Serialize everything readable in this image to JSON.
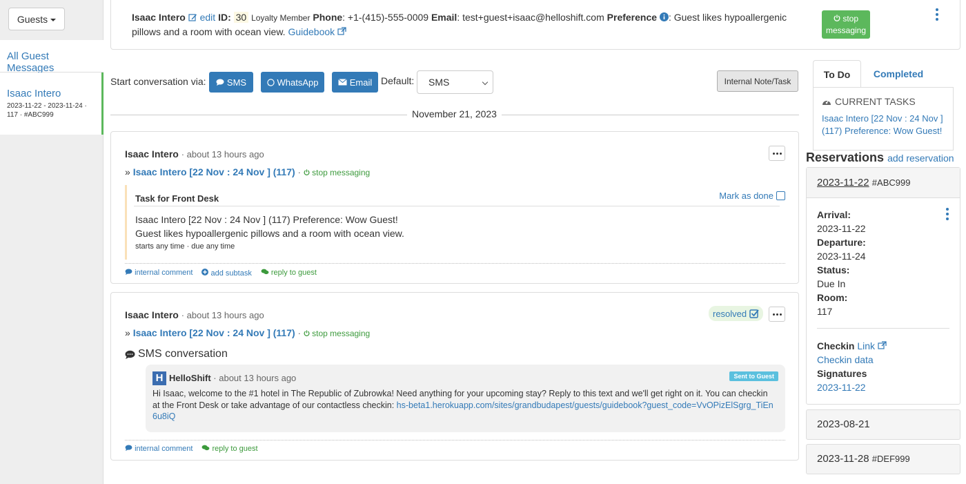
{
  "sidebar": {
    "guests_button": "Guests",
    "all_messages": "All Guest Messages",
    "guest_name": "Isaac Intero",
    "guest_meta": "2023-11-22 - 2023-11-24 · 117 · #ABC999"
  },
  "guest_info": {
    "name": "Isaac Intero",
    "edit": "edit",
    "id_label": "ID:",
    "id": "30",
    "loyalty": "Loyalty Member",
    "phone_label": "Phone",
    "phone": ": +1-(415)-555-0009",
    "email_label": "Email",
    "email": ": test+guest+isaac@helloshift.com",
    "preference_label": "Preference",
    "preference": ": Guest likes hypoallergenic pillows and a room with ocean view.",
    "guidebook": "Guidebook",
    "stop_button": "stop messaging"
  },
  "conversation_bar": {
    "label": "Start conversation via:",
    "sms": "SMS",
    "whatsapp": "WhatsApp",
    "email": "Email",
    "default_label": "Default:",
    "default_value": "SMS",
    "internal_note": "Internal Note/Task"
  },
  "date_separator": "November 21, 2023",
  "message1": {
    "author": "Isaac Intero",
    "time": "· about 13 hours ago",
    "prefix": "»",
    "reservation": "Isaac Intero [22 Nov : 24 Nov ] (117)",
    "stop": "stop messaging",
    "task_title": "Task for Front Desk",
    "mark_done": "Mark as done",
    "task_line1": "Isaac Intero [22 Nov : 24 Nov ] (117) Preference: Wow Guest!",
    "task_line2": "Guest likes hypoallergenic pillows and a room with ocean view.",
    "task_time": "starts any time · due any time",
    "internal_comment": "internal comment",
    "add_subtask": "add subtask",
    "reply": "reply to guest"
  },
  "message2": {
    "author": "Isaac Intero",
    "time": "· about 13 hours ago",
    "prefix": "»",
    "reservation": "Isaac Intero [22 Nov : 24 Nov ] (117)",
    "stop": "stop messaging",
    "resolved": "resolved",
    "sms_title": "SMS conversation",
    "sender": "HelloShift",
    "sender_time": "· about 13 hours ago",
    "sent_badge": "Sent to Guest",
    "sms_body": "Hi Isaac, welcome to the #1 hotel in The Republic of Zubrowka! Need anything for your upcoming stay? Reply to this text and we'll get right on it. You can checkin at the Front Desk or take advantage of our contactless checkin: ",
    "sms_link": "hs-beta1.herokuapp.com/sites/grandbudapest/guests/guidebook?guest_code=VvOPizElSgrg_TiEn6u8iQ",
    "internal_comment": "internal comment",
    "reply": "reply to guest"
  },
  "tasks": {
    "tab_todo": "To Do",
    "tab_completed": "Completed",
    "current_tasks": "CURRENT TASKS",
    "task_link": "Isaac Intero [22 Nov : 24 Nov ] (117) Preference: Wow Guest!"
  },
  "reservations": {
    "title": "Reservations",
    "add": "add reservation",
    "r1_date": "2023-11-22",
    "r1_code": "#ABC999",
    "arrival_label": "Arrival:",
    "arrival": "2023-11-22",
    "departure_label": "Departure:",
    "departure": "2023-11-24",
    "status_label": "Status:",
    "status": "Due In",
    "room_label": "Room:",
    "room": "117",
    "checkin_label": "Checkin",
    "checkin_link": "Link",
    "checkin_data": "Checkin data",
    "signatures_label": "Signatures",
    "signature_date": "2023-11-22",
    "r2_date": "2023-08-21",
    "r3_date": "2023-11-28",
    "r3_code": "#DEF999"
  },
  "colors": {
    "link": "#337ab7",
    "success": "#5cb85c",
    "info_badge": "#5bc0de"
  }
}
